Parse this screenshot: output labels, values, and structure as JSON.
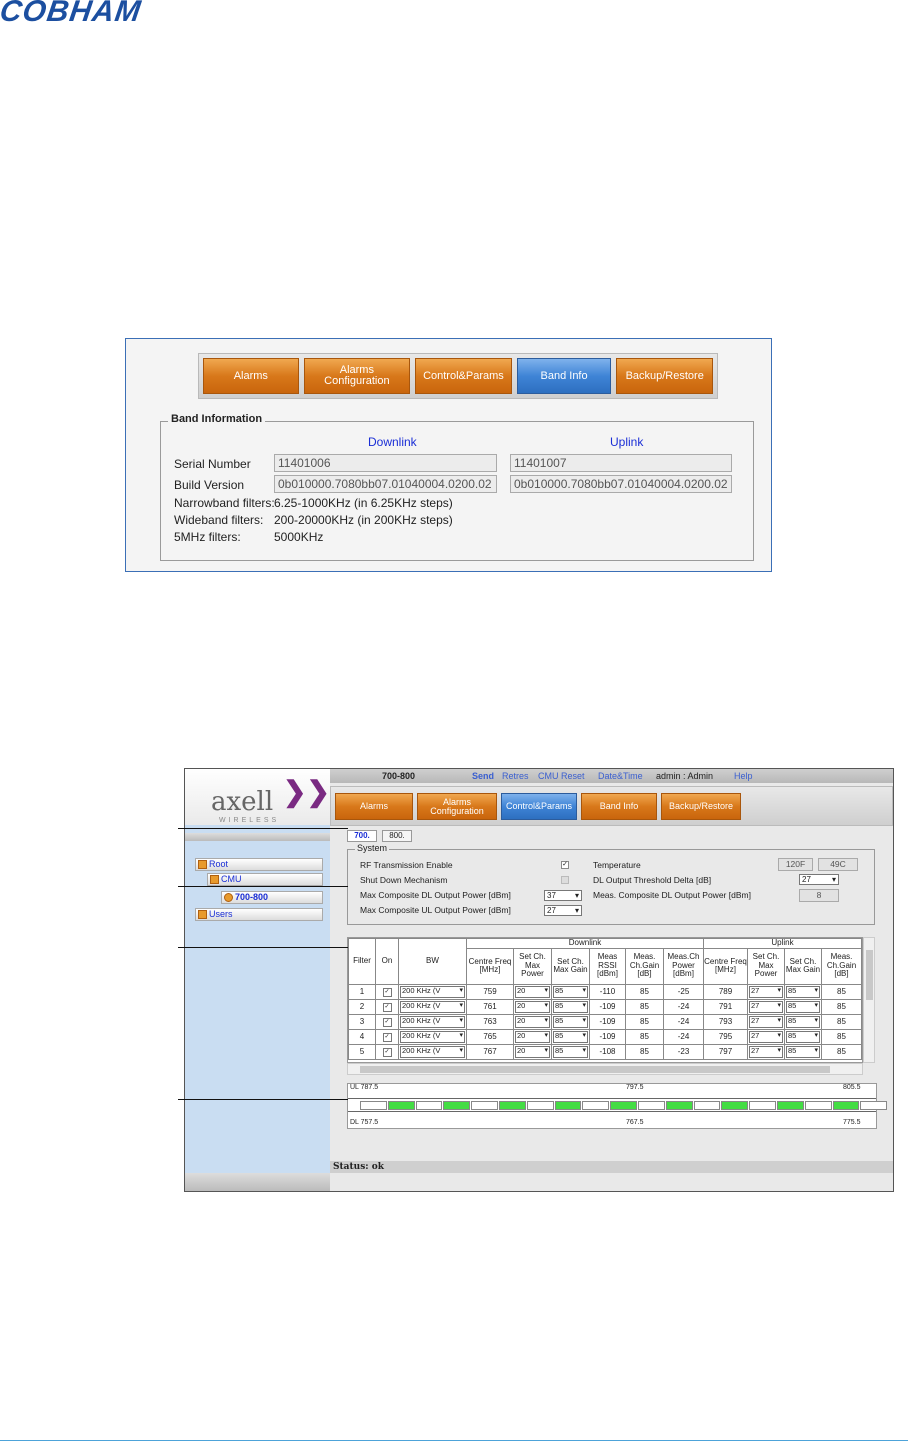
{
  "header": {
    "logo_text": "COBHAM"
  },
  "shot1": {
    "tabs": [
      "Alarms",
      "Alarms\nConfiguration",
      "Control&Params",
      "Band Info",
      "Backup/Restore"
    ],
    "active_tab": "Band Info",
    "legend": "Band Information",
    "downlink_label": "Downlink",
    "uplink_label": "Uplink",
    "serial_label": "Serial Number",
    "build_label": "Build Version",
    "downlink_serial": "11401006",
    "uplink_serial": "11401007",
    "downlink_build": "0b010000.7080bb07.01040004.0200.02",
    "uplink_build": "0b010000.7080bb07.01040004.0200.02",
    "narrowband_label": "Narrowband filters:",
    "narrowband_value": "6.25-1000KHz (in 6.25KHz steps)",
    "wideband_label": "Wideband filters:",
    "wideband_value": "200-20000KHz (in 200KHz steps)",
    "fivemhz_label": "5MHz filters:",
    "fivemhz_value": "5000KHz"
  },
  "shot2": {
    "logo": {
      "brand": "axell",
      "sub": "WIRELESS"
    },
    "topbar": {
      "device": "700-800",
      "send": "Send",
      "retries": "Retres",
      "cmu_reset": "CMU Reset",
      "datetime": "Date&Time",
      "user": "admin : Admin",
      "help": "Help"
    },
    "tabs": [
      "Alarms",
      "Alarms\nConfiguration",
      "Control&Params",
      "Band Info",
      "Backup/Restore"
    ],
    "active_tab": "Control&Params",
    "tree": {
      "root": "Root",
      "cmu": "CMU",
      "device": "700-800",
      "users": "Users"
    },
    "subtabs": [
      "700.",
      "800."
    ],
    "system": {
      "legend": "System",
      "rf_enable": "RF Transmission Enable",
      "shutdown": "Shut Down Mechanism",
      "max_dl": "Max Composite DL Output Power [dBm]",
      "max_dl_value": "37",
      "max_ul": "Max Composite UL Output Power [dBm]",
      "max_ul_value": "27",
      "temperature": "Temperature",
      "temp_f": "120F",
      "temp_c": "49C",
      "dl_delta": "DL Output Threshold Delta [dB]",
      "dl_delta_value": "27",
      "meas_dl": "Meas. Composite DL Output Power [dBm]",
      "meas_dl_value": "8"
    },
    "table": {
      "group_downlink": "Downlink",
      "group_uplink": "Uplink",
      "headers": [
        "Filter",
        "On",
        "BW",
        "Centre Freq [MHz]",
        "Set Ch. Max Power",
        "Set Ch. Max Gain",
        "Meas RSSI [dBm]",
        "Meas. Ch.Gain [dB]",
        "Meas.Ch Power [dBm]",
        "Centre Freq [MHz]",
        "Set Ch. Max Power",
        "Set Ch. Max Gain",
        "Meas. Ch.Gain [dB]"
      ],
      "rows": [
        [
          "1",
          "200 KHz (V",
          "759",
          "20",
          "85",
          "-110",
          "85",
          "-25",
          "789",
          "27",
          "85",
          "85"
        ],
        [
          "2",
          "200 KHz (V",
          "761",
          "20",
          "85",
          "-109",
          "85",
          "-24",
          "791",
          "27",
          "85",
          "85"
        ],
        [
          "3",
          "200 KHz (V",
          "763",
          "20",
          "85",
          "-109",
          "85",
          "-24",
          "793",
          "27",
          "85",
          "85"
        ],
        [
          "4",
          "200 KHz (V",
          "765",
          "20",
          "85",
          "-109",
          "85",
          "-24",
          "795",
          "27",
          "85",
          "85"
        ],
        [
          "5",
          "200 KHz (V",
          "767",
          "20",
          "85",
          "-108",
          "85",
          "-23",
          "797",
          "27",
          "85",
          "85"
        ]
      ]
    },
    "spectrum": {
      "ul_left": "UL 787.5",
      "ul_mid": "797.5",
      "ul_right": "805.5",
      "dl_left": "DL 757.5",
      "dl_mid": "767.5",
      "dl_right": "775.5",
      "active_color": "#44dd44"
    },
    "status": "Status: ok"
  }
}
